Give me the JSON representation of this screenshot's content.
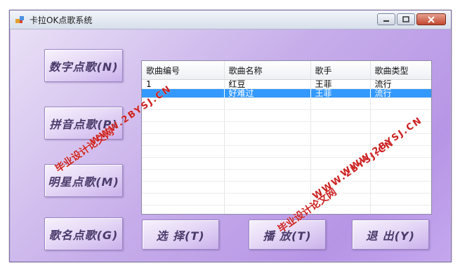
{
  "window": {
    "title": "卡拉OK点歌系统",
    "min_glyph": "▭",
    "max_glyph": "▫",
    "close_glyph": "✕"
  },
  "left_buttons": [
    {
      "label": "数字点歌(N)"
    },
    {
      "label": "拼音点歌(P)"
    },
    {
      "label": "明星点歌(M)"
    },
    {
      "label": "歌名点歌(G)"
    }
  ],
  "bottom_buttons": {
    "select": "选 择(T)",
    "play": "播 放(T)",
    "exit": "退 出(Y)"
  },
  "grid": {
    "columns": [
      "歌曲编号",
      "歌曲名称",
      "歌手",
      "歌曲类型"
    ],
    "rows": [
      [
        "1",
        "红豆",
        "王菲",
        "流行"
      ],
      [
        "",
        "好难过",
        "王菲",
        "流行"
      ]
    ]
  },
  "watermarks": {
    "cn1": "毕业设计论文网",
    "url1": "WWW.2BYSJ.CN",
    "cn2": "毕业设计论文网",
    "url2": "WWW.2BYSJ.CN",
    "url3": "WWW.2BYSJ.CN"
  },
  "colors": {
    "selection": "#3399ff",
    "watermark": "#cc1f1f",
    "client_bg": "#c7aeea"
  }
}
